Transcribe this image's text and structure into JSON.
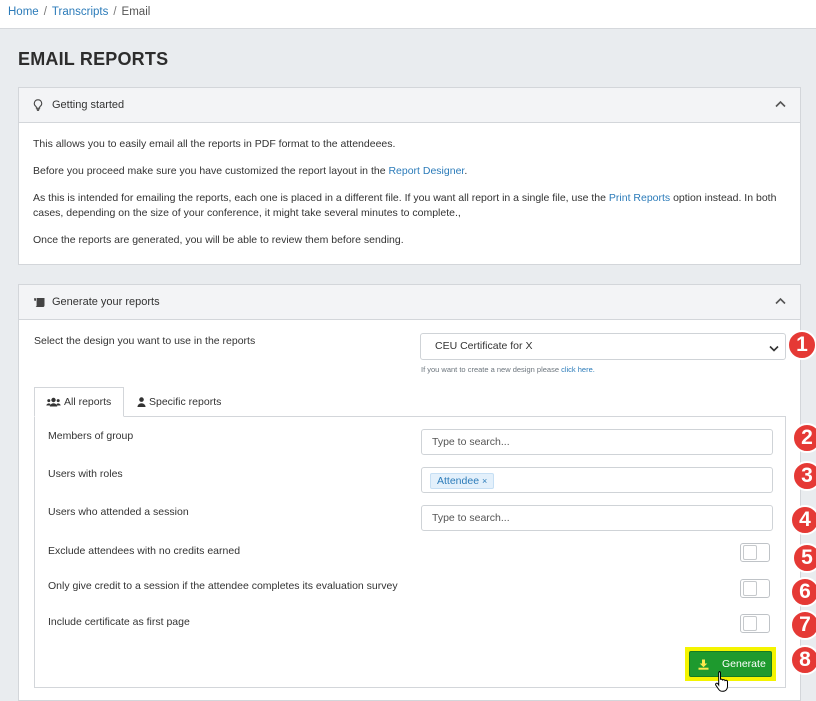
{
  "breadcrumb": {
    "home": "Home",
    "transcripts": "Transcripts",
    "current": "Email",
    "separator": "/"
  },
  "page_title": "EMAIL REPORTS",
  "getting_started": {
    "title": "Getting started",
    "p1": "This allows you to easily email all the reports in PDF format to the attendeees.",
    "p2_before": "Before you proceed make sure you have customized the report layout in the ",
    "p2_link": "Report Designer",
    "p2_after": ".",
    "p3_before": "As this is intended for emailing the reports, each one is placed in a different file. If you want all report in a single file, use the ",
    "p3_link": "Print Reports",
    "p3_after": " option instead. In both cases, depending on the size of your conference, it might take several minutes to complete.,",
    "p4": "Once the reports are generated, you will be able to review them before sending."
  },
  "generate": {
    "title": "Generate your reports",
    "design_label": "Select the design you want to use in the reports",
    "design_value": "CEU Certificate for X",
    "design_hint": "If you want to create a new design please ",
    "design_hint_link": "click here.",
    "tabs": {
      "all": "All reports",
      "specific": "Specific reports"
    },
    "members_label": "Members of group",
    "members_placeholder": "Type to search...",
    "roles_label": "Users with roles",
    "roles_chip": "Attendee",
    "roles_chip_remove": "×",
    "session_label": "Users who attended a session",
    "session_placeholder": "Type to search...",
    "exclude_label": "Exclude attendees with no credits earned",
    "survey_label": "Only give credit to a session if the attendee completes its evaluation survey",
    "cert_label": "Include certificate as first page",
    "toggles": {
      "exclude": false,
      "survey": false,
      "cert": false
    },
    "button": "Generate"
  },
  "markers": [
    "1",
    "2",
    "3",
    "4",
    "5",
    "6",
    "7",
    "8"
  ],
  "colors": {
    "link": "#2b7bb9",
    "generate": "#1e9a2e",
    "highlight": "#f4f400",
    "marker": "#e53935"
  }
}
